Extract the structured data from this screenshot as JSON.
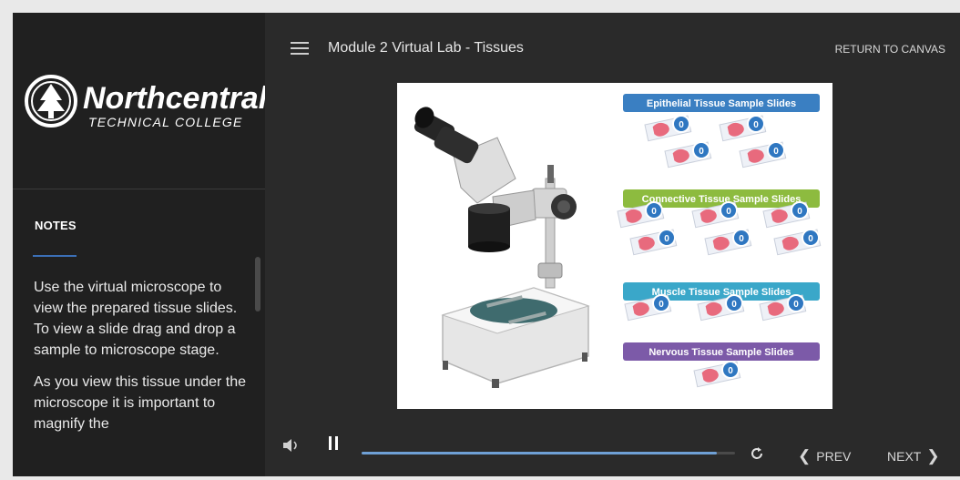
{
  "header": {
    "menu_icon": "hamburger-icon",
    "title": "Module 2 Virtual Lab - Tissues",
    "return_label": "RETURN TO CANVAS"
  },
  "sidebar": {
    "logo": {
      "name": "Northcentral",
      "subtitle": "TECHNICAL COLLEGE"
    },
    "notes_tab": "NOTES",
    "notes_paragraphs": [
      "Use the virtual microscope to view the prepared tissue slides. To view a slide drag and drop a sample to microscope stage.",
      "As you view this tissue under the microscope it is important to magnify the"
    ]
  },
  "slide": {
    "categories": [
      {
        "label": "Epithelial Tissue Sample Slides",
        "color": "#3a7fc2",
        "slides": 4
      },
      {
        "label": "Connective Tissue Sample Slides",
        "color": "#8dbb3f",
        "slides": 6
      },
      {
        "label": "Muscle Tissue Sample Slides",
        "color": "#3aa7c9",
        "slides": 3
      },
      {
        "label": "Nervous Tissue Sample Slides",
        "color": "#7c5aa8",
        "slides": 1
      }
    ],
    "info_icon_text": "0"
  },
  "player": {
    "volume_icon": "speaker-icon",
    "pause_icon": "pause-icon",
    "progress": 0.95,
    "replay_icon": "replay-icon",
    "prev_label": "PREV",
    "next_label": "NEXT",
    "colors": {
      "progress_fill": "#6fa0d6",
      "accent": "#3b6fb6"
    }
  }
}
